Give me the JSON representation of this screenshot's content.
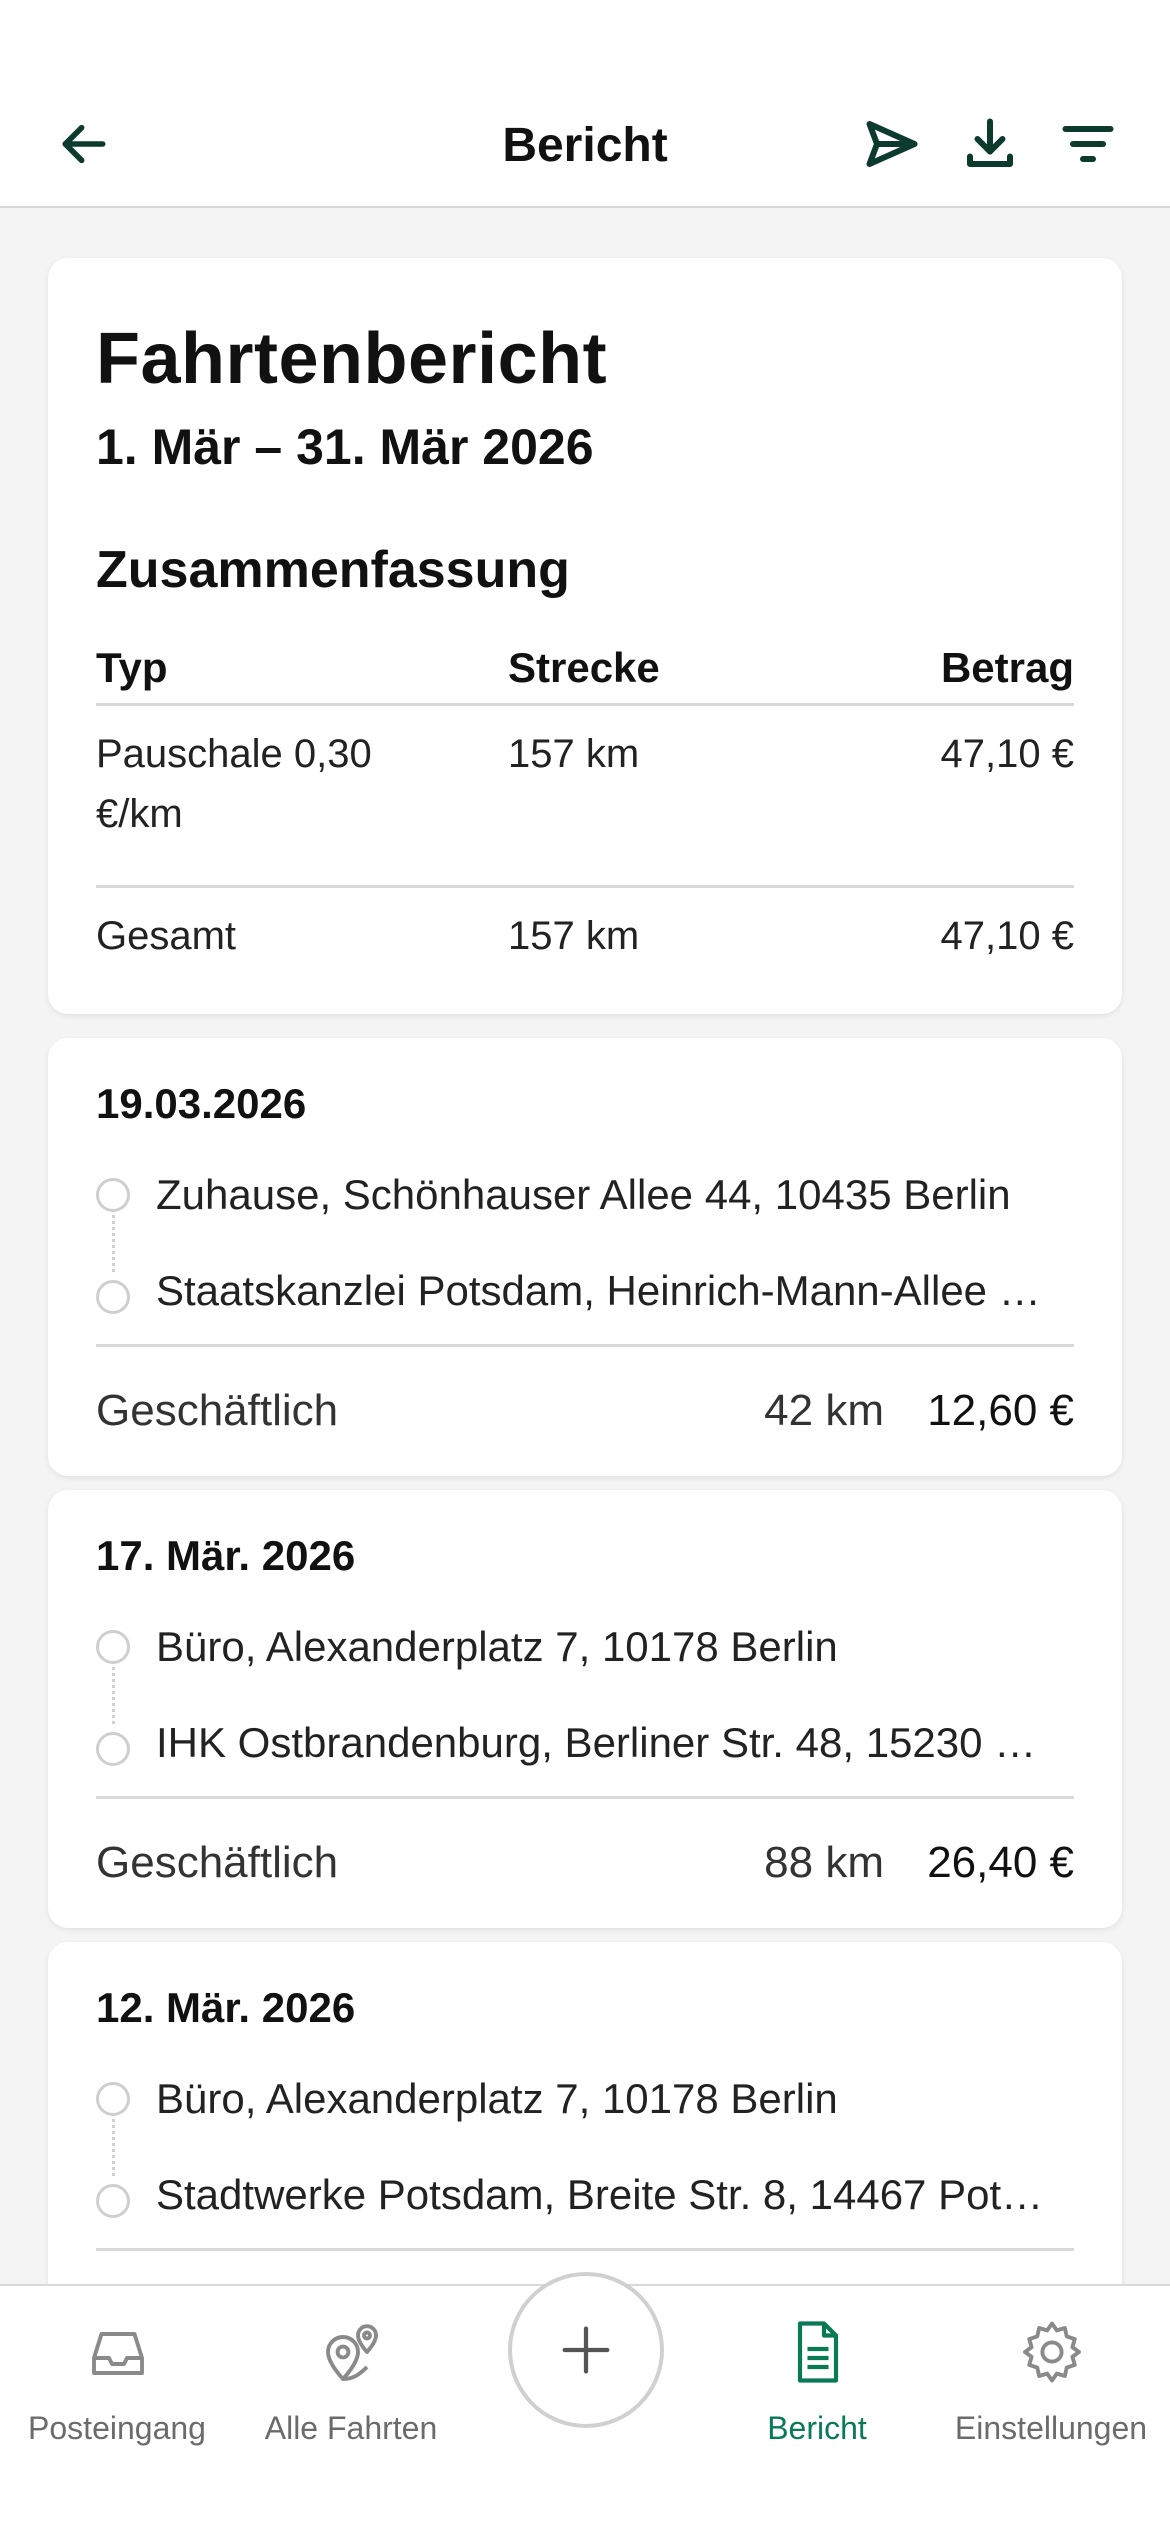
{
  "header": {
    "title": "Bericht",
    "back_icon": "arrow-left-icon",
    "send_icon": "send-icon",
    "download_icon": "download-icon",
    "filter_icon": "filter-icon"
  },
  "report": {
    "title": "Fahrtenbericht",
    "period": "1. Mär – 31. Mär 2026",
    "summary_title": "Zusammenfassung",
    "columns": {
      "type": "Typ",
      "distance": "Strecke",
      "amount": "Betrag"
    },
    "rows": [
      {
        "type": "Pauschale 0,30 €/km",
        "distance": "157 km",
        "amount": "47,10 €"
      },
      {
        "type": "Gesamt",
        "distance": "157 km",
        "amount": "47,10 €"
      }
    ]
  },
  "trips": [
    {
      "date": "19.03.2026",
      "from": "Zuhause, Schönhauser Allee 44, 10435 Berlin",
      "to": "Staatskanzlei Potsdam, Heinrich-Mann-Allee …",
      "category": "Geschäftlich",
      "distance": "42 km",
      "amount": "12,60 €"
    },
    {
      "date": "17. Mär. 2026",
      "from": "Büro, Alexanderplatz 7, 10178 Berlin",
      "to": "IHK Ostbrandenburg, Berliner Str. 48, 15230 …",
      "category": "Geschäftlich",
      "distance": "88 km",
      "amount": "26,40 €"
    },
    {
      "date": "12. Mär. 2026",
      "from": "Büro, Alexanderplatz 7, 10178 Berlin",
      "to": "Stadtwerke Potsdam, Breite Str. 8, 14467 Pot…"
    }
  ],
  "tabbar": {
    "tabs": [
      {
        "label": "Posteingang",
        "icon": "inbox-icon"
      },
      {
        "label": "Alle Fahrten",
        "icon": "map-pins-icon"
      },
      {
        "label": "Bericht",
        "icon": "document-icon",
        "active": true
      },
      {
        "label": "Einstellungen",
        "icon": "gear-icon"
      }
    ],
    "add_icon": "plus-icon"
  },
  "colors": {
    "accent": "#0a7a55",
    "header_icon": "#0c3b2e",
    "background": "#f4f4f4",
    "divider": "#d9d9d9"
  }
}
